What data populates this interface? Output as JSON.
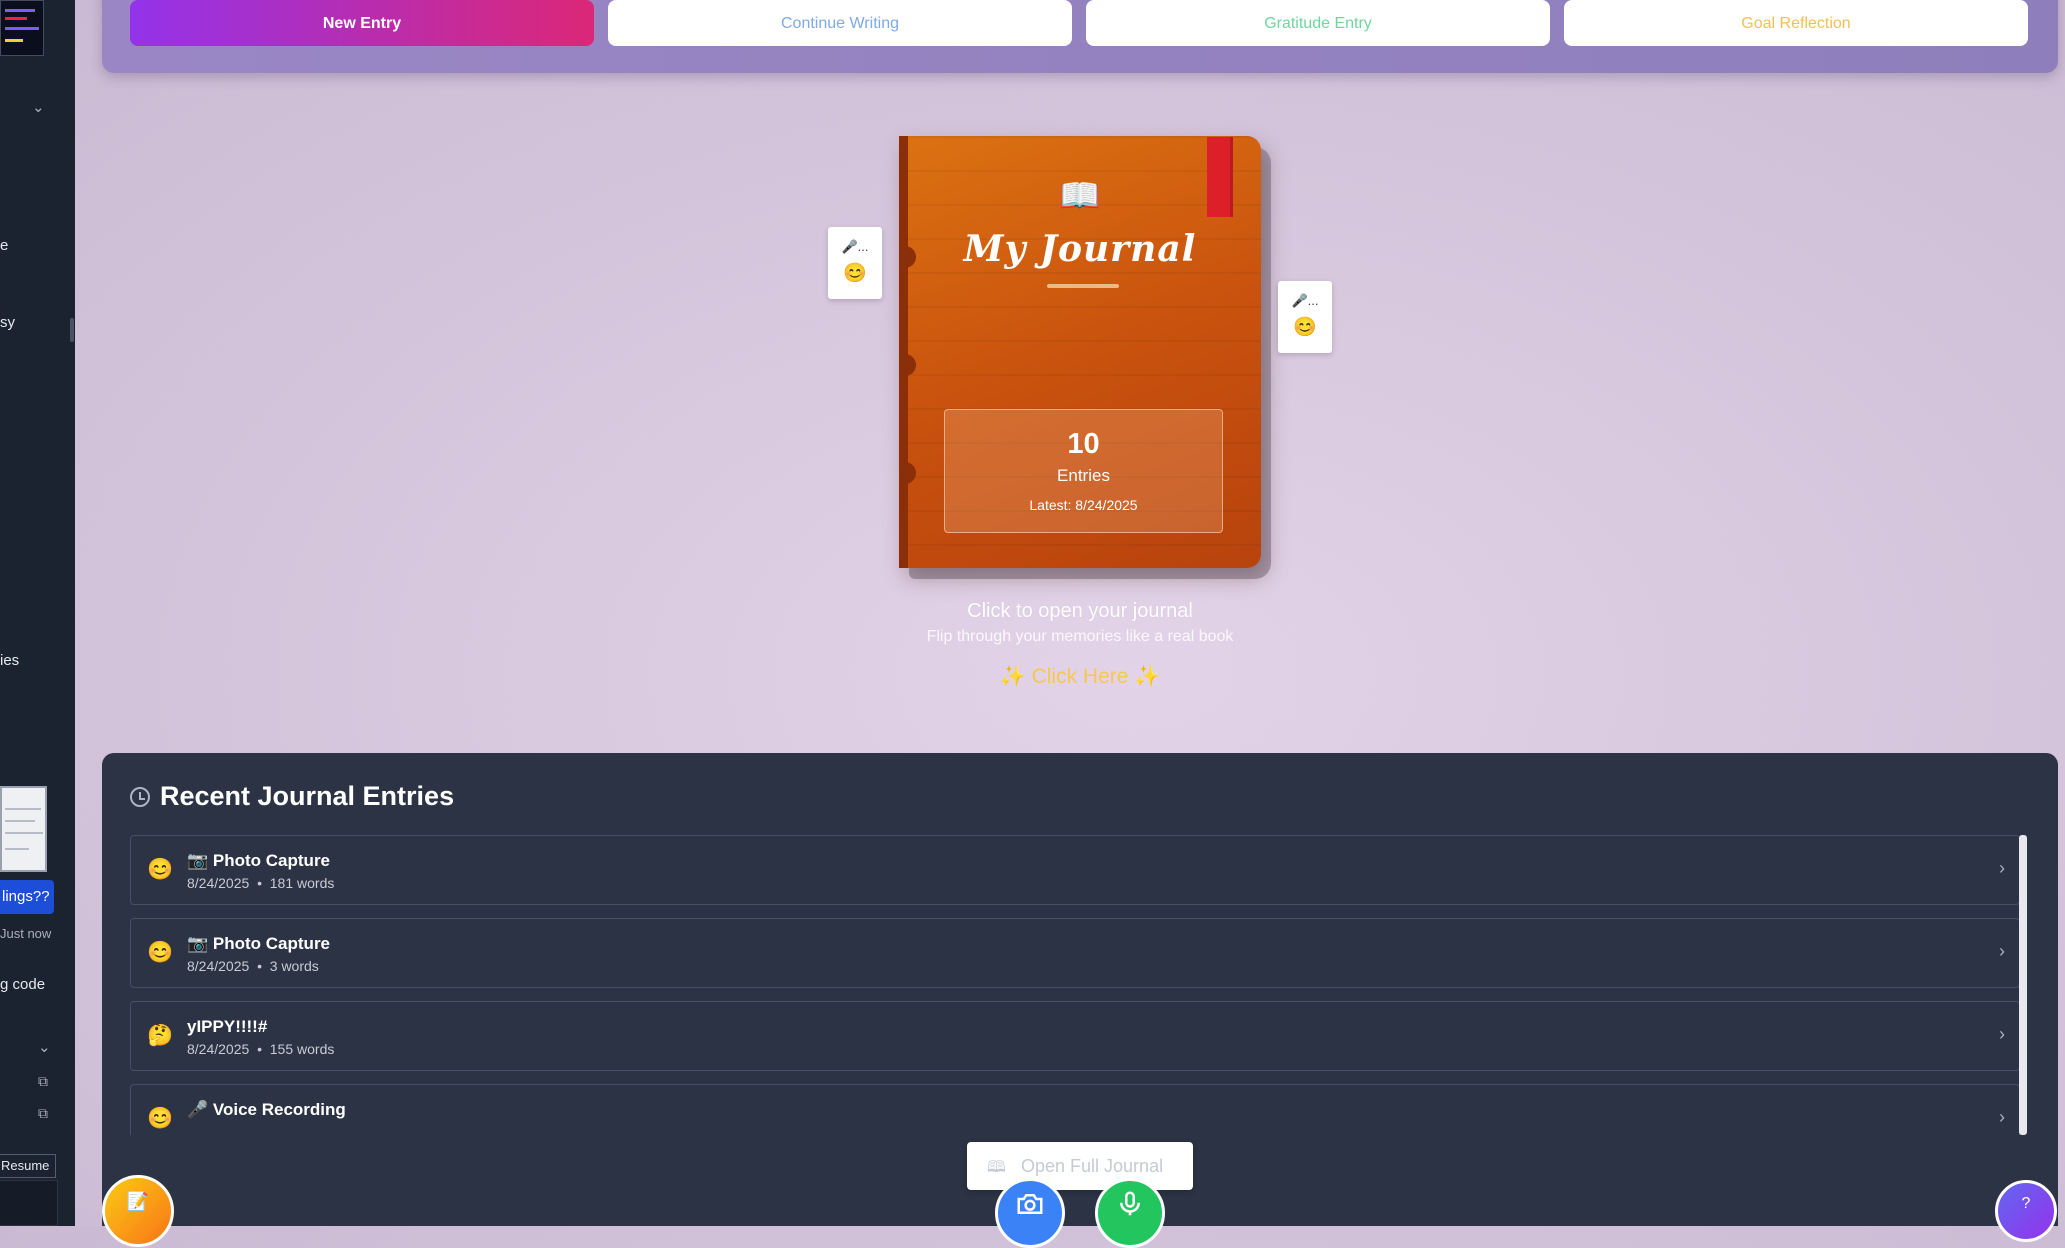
{
  "top_actions": {
    "new_entry": "New Entry",
    "continue_writing": "Continue Writing",
    "gratitude_entry": "Gratitude Entry",
    "goal_reflection": "Goal Reflection"
  },
  "sidebar": {
    "fragment_e": "e",
    "fragment_sy": "sy",
    "fragment_ies": "ies",
    "chat_pill": "lings??",
    "timestamp": "Just now",
    "fragment_code": "g code",
    "resume_label": "Resume"
  },
  "journal": {
    "book_icon": "📖",
    "title": "My Journal",
    "entry_count": "10",
    "entries_label": "Entries",
    "latest": "Latest: 8/24/2025",
    "note_left": {
      "mic": "🎤...",
      "emoji": "😊"
    },
    "note_right": {
      "mic": "🎤...",
      "emoji": "😊"
    },
    "hint_title": "Click to open your journal",
    "hint_subtitle": "Flip through your memories like a real book",
    "hint_cta": "✨ Click Here ✨"
  },
  "recent": {
    "heading": "Recent Journal Entries",
    "entries": [
      {
        "emoji": "😊",
        "icon": "📷",
        "title": "Photo Capture",
        "date": "8/24/2025",
        "words": "181 words"
      },
      {
        "emoji": "😊",
        "icon": "📷",
        "title": "Photo Capture",
        "date": "8/24/2025",
        "words": "3 words"
      },
      {
        "emoji": "🤔",
        "icon": "",
        "title": "yIPPY!!!!#",
        "date": "8/24/2025",
        "words": "155 words"
      },
      {
        "emoji": "😊",
        "icon": "🎤",
        "title": "Voice Recording",
        "date": "",
        "words": ""
      }
    ],
    "open_full": "Open Full Journal"
  },
  "icons": {
    "camera": "camera-icon",
    "mic": "microphone-icon",
    "help": "help-icon",
    "clock": "clock-icon",
    "book": "book-icon",
    "chevron": "chevron-right-icon"
  },
  "colors": {
    "new_entry_gradient_start": "#9333ea",
    "new_entry_gradient_end": "#db2777",
    "continue": "#7fa9e8",
    "gratitude": "#6fd6a0",
    "goal": "#f1c14f",
    "book_cover": "#c9520e",
    "ribbon": "#dc1f28",
    "panel_bg": "#2b3344",
    "camera_fab": "#3b82f6",
    "mic_fab": "#22c55e"
  }
}
